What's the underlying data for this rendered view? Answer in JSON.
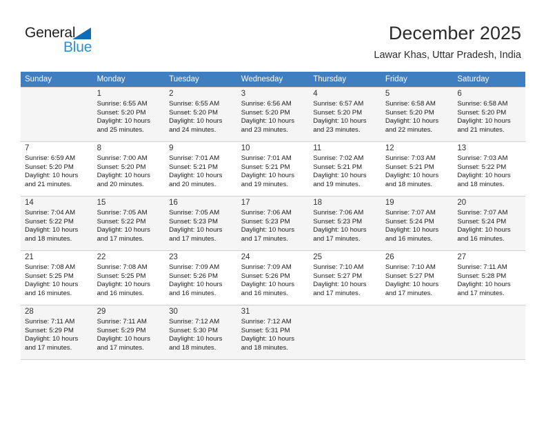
{
  "brand": {
    "name_dark": "General",
    "name_light": "Blue",
    "accent_color": "#2b8fd4",
    "triangle_color": "#0f6cb6"
  },
  "header": {
    "title": "December 2025",
    "subtitle": "Lawar Khas, Uttar Pradesh, India"
  },
  "calendar": {
    "header_bg": "#3f7fc1",
    "weekday_headers": [
      "Sunday",
      "Monday",
      "Tuesday",
      "Wednesday",
      "Thursday",
      "Friday",
      "Saturday"
    ],
    "weeks": [
      [
        {
          "day": "",
          "sunrise": "",
          "sunset": "",
          "daylight1": "",
          "daylight2": "",
          "empty": true
        },
        {
          "day": "1",
          "sunrise": "Sunrise: 6:55 AM",
          "sunset": "Sunset: 5:20 PM",
          "daylight1": "Daylight: 10 hours",
          "daylight2": "and 25 minutes."
        },
        {
          "day": "2",
          "sunrise": "Sunrise: 6:55 AM",
          "sunset": "Sunset: 5:20 PM",
          "daylight1": "Daylight: 10 hours",
          "daylight2": "and 24 minutes."
        },
        {
          "day": "3",
          "sunrise": "Sunrise: 6:56 AM",
          "sunset": "Sunset: 5:20 PM",
          "daylight1": "Daylight: 10 hours",
          "daylight2": "and 23 minutes."
        },
        {
          "day": "4",
          "sunrise": "Sunrise: 6:57 AM",
          "sunset": "Sunset: 5:20 PM",
          "daylight1": "Daylight: 10 hours",
          "daylight2": "and 23 minutes."
        },
        {
          "day": "5",
          "sunrise": "Sunrise: 6:58 AM",
          "sunset": "Sunset: 5:20 PM",
          "daylight1": "Daylight: 10 hours",
          "daylight2": "and 22 minutes."
        },
        {
          "day": "6",
          "sunrise": "Sunrise: 6:58 AM",
          "sunset": "Sunset: 5:20 PM",
          "daylight1": "Daylight: 10 hours",
          "daylight2": "and 21 minutes."
        }
      ],
      [
        {
          "day": "7",
          "sunrise": "Sunrise: 6:59 AM",
          "sunset": "Sunset: 5:20 PM",
          "daylight1": "Daylight: 10 hours",
          "daylight2": "and 21 minutes."
        },
        {
          "day": "8",
          "sunrise": "Sunrise: 7:00 AM",
          "sunset": "Sunset: 5:20 PM",
          "daylight1": "Daylight: 10 hours",
          "daylight2": "and 20 minutes."
        },
        {
          "day": "9",
          "sunrise": "Sunrise: 7:01 AM",
          "sunset": "Sunset: 5:21 PM",
          "daylight1": "Daylight: 10 hours",
          "daylight2": "and 20 minutes."
        },
        {
          "day": "10",
          "sunrise": "Sunrise: 7:01 AM",
          "sunset": "Sunset: 5:21 PM",
          "daylight1": "Daylight: 10 hours",
          "daylight2": "and 19 minutes."
        },
        {
          "day": "11",
          "sunrise": "Sunrise: 7:02 AM",
          "sunset": "Sunset: 5:21 PM",
          "daylight1": "Daylight: 10 hours",
          "daylight2": "and 19 minutes."
        },
        {
          "day": "12",
          "sunrise": "Sunrise: 7:03 AM",
          "sunset": "Sunset: 5:21 PM",
          "daylight1": "Daylight: 10 hours",
          "daylight2": "and 18 minutes."
        },
        {
          "day": "13",
          "sunrise": "Sunrise: 7:03 AM",
          "sunset": "Sunset: 5:22 PM",
          "daylight1": "Daylight: 10 hours",
          "daylight2": "and 18 minutes."
        }
      ],
      [
        {
          "day": "14",
          "sunrise": "Sunrise: 7:04 AM",
          "sunset": "Sunset: 5:22 PM",
          "daylight1": "Daylight: 10 hours",
          "daylight2": "and 18 minutes."
        },
        {
          "day": "15",
          "sunrise": "Sunrise: 7:05 AM",
          "sunset": "Sunset: 5:22 PM",
          "daylight1": "Daylight: 10 hours",
          "daylight2": "and 17 minutes."
        },
        {
          "day": "16",
          "sunrise": "Sunrise: 7:05 AM",
          "sunset": "Sunset: 5:23 PM",
          "daylight1": "Daylight: 10 hours",
          "daylight2": "and 17 minutes."
        },
        {
          "day": "17",
          "sunrise": "Sunrise: 7:06 AM",
          "sunset": "Sunset: 5:23 PM",
          "daylight1": "Daylight: 10 hours",
          "daylight2": "and 17 minutes."
        },
        {
          "day": "18",
          "sunrise": "Sunrise: 7:06 AM",
          "sunset": "Sunset: 5:23 PM",
          "daylight1": "Daylight: 10 hours",
          "daylight2": "and 17 minutes."
        },
        {
          "day": "19",
          "sunrise": "Sunrise: 7:07 AM",
          "sunset": "Sunset: 5:24 PM",
          "daylight1": "Daylight: 10 hours",
          "daylight2": "and 16 minutes."
        },
        {
          "day": "20",
          "sunrise": "Sunrise: 7:07 AM",
          "sunset": "Sunset: 5:24 PM",
          "daylight1": "Daylight: 10 hours",
          "daylight2": "and 16 minutes."
        }
      ],
      [
        {
          "day": "21",
          "sunrise": "Sunrise: 7:08 AM",
          "sunset": "Sunset: 5:25 PM",
          "daylight1": "Daylight: 10 hours",
          "daylight2": "and 16 minutes."
        },
        {
          "day": "22",
          "sunrise": "Sunrise: 7:08 AM",
          "sunset": "Sunset: 5:25 PM",
          "daylight1": "Daylight: 10 hours",
          "daylight2": "and 16 minutes."
        },
        {
          "day": "23",
          "sunrise": "Sunrise: 7:09 AM",
          "sunset": "Sunset: 5:26 PM",
          "daylight1": "Daylight: 10 hours",
          "daylight2": "and 16 minutes."
        },
        {
          "day": "24",
          "sunrise": "Sunrise: 7:09 AM",
          "sunset": "Sunset: 5:26 PM",
          "daylight1": "Daylight: 10 hours",
          "daylight2": "and 16 minutes."
        },
        {
          "day": "25",
          "sunrise": "Sunrise: 7:10 AM",
          "sunset": "Sunset: 5:27 PM",
          "daylight1": "Daylight: 10 hours",
          "daylight2": "and 17 minutes."
        },
        {
          "day": "26",
          "sunrise": "Sunrise: 7:10 AM",
          "sunset": "Sunset: 5:27 PM",
          "daylight1": "Daylight: 10 hours",
          "daylight2": "and 17 minutes."
        },
        {
          "day": "27",
          "sunrise": "Sunrise: 7:11 AM",
          "sunset": "Sunset: 5:28 PM",
          "daylight1": "Daylight: 10 hours",
          "daylight2": "and 17 minutes."
        }
      ],
      [
        {
          "day": "28",
          "sunrise": "Sunrise: 7:11 AM",
          "sunset": "Sunset: 5:29 PM",
          "daylight1": "Daylight: 10 hours",
          "daylight2": "and 17 minutes."
        },
        {
          "day": "29",
          "sunrise": "Sunrise: 7:11 AM",
          "sunset": "Sunset: 5:29 PM",
          "daylight1": "Daylight: 10 hours",
          "daylight2": "and 17 minutes."
        },
        {
          "day": "30",
          "sunrise": "Sunrise: 7:12 AM",
          "sunset": "Sunset: 5:30 PM",
          "daylight1": "Daylight: 10 hours",
          "daylight2": "and 18 minutes."
        },
        {
          "day": "31",
          "sunrise": "Sunrise: 7:12 AM",
          "sunset": "Sunset: 5:31 PM",
          "daylight1": "Daylight: 10 hours",
          "daylight2": "and 18 minutes."
        },
        {
          "day": "",
          "sunrise": "",
          "sunset": "",
          "daylight1": "",
          "daylight2": "",
          "empty": true
        },
        {
          "day": "",
          "sunrise": "",
          "sunset": "",
          "daylight1": "",
          "daylight2": "",
          "empty": true
        },
        {
          "day": "",
          "sunrise": "",
          "sunset": "",
          "daylight1": "",
          "daylight2": "",
          "empty": true
        }
      ]
    ]
  }
}
